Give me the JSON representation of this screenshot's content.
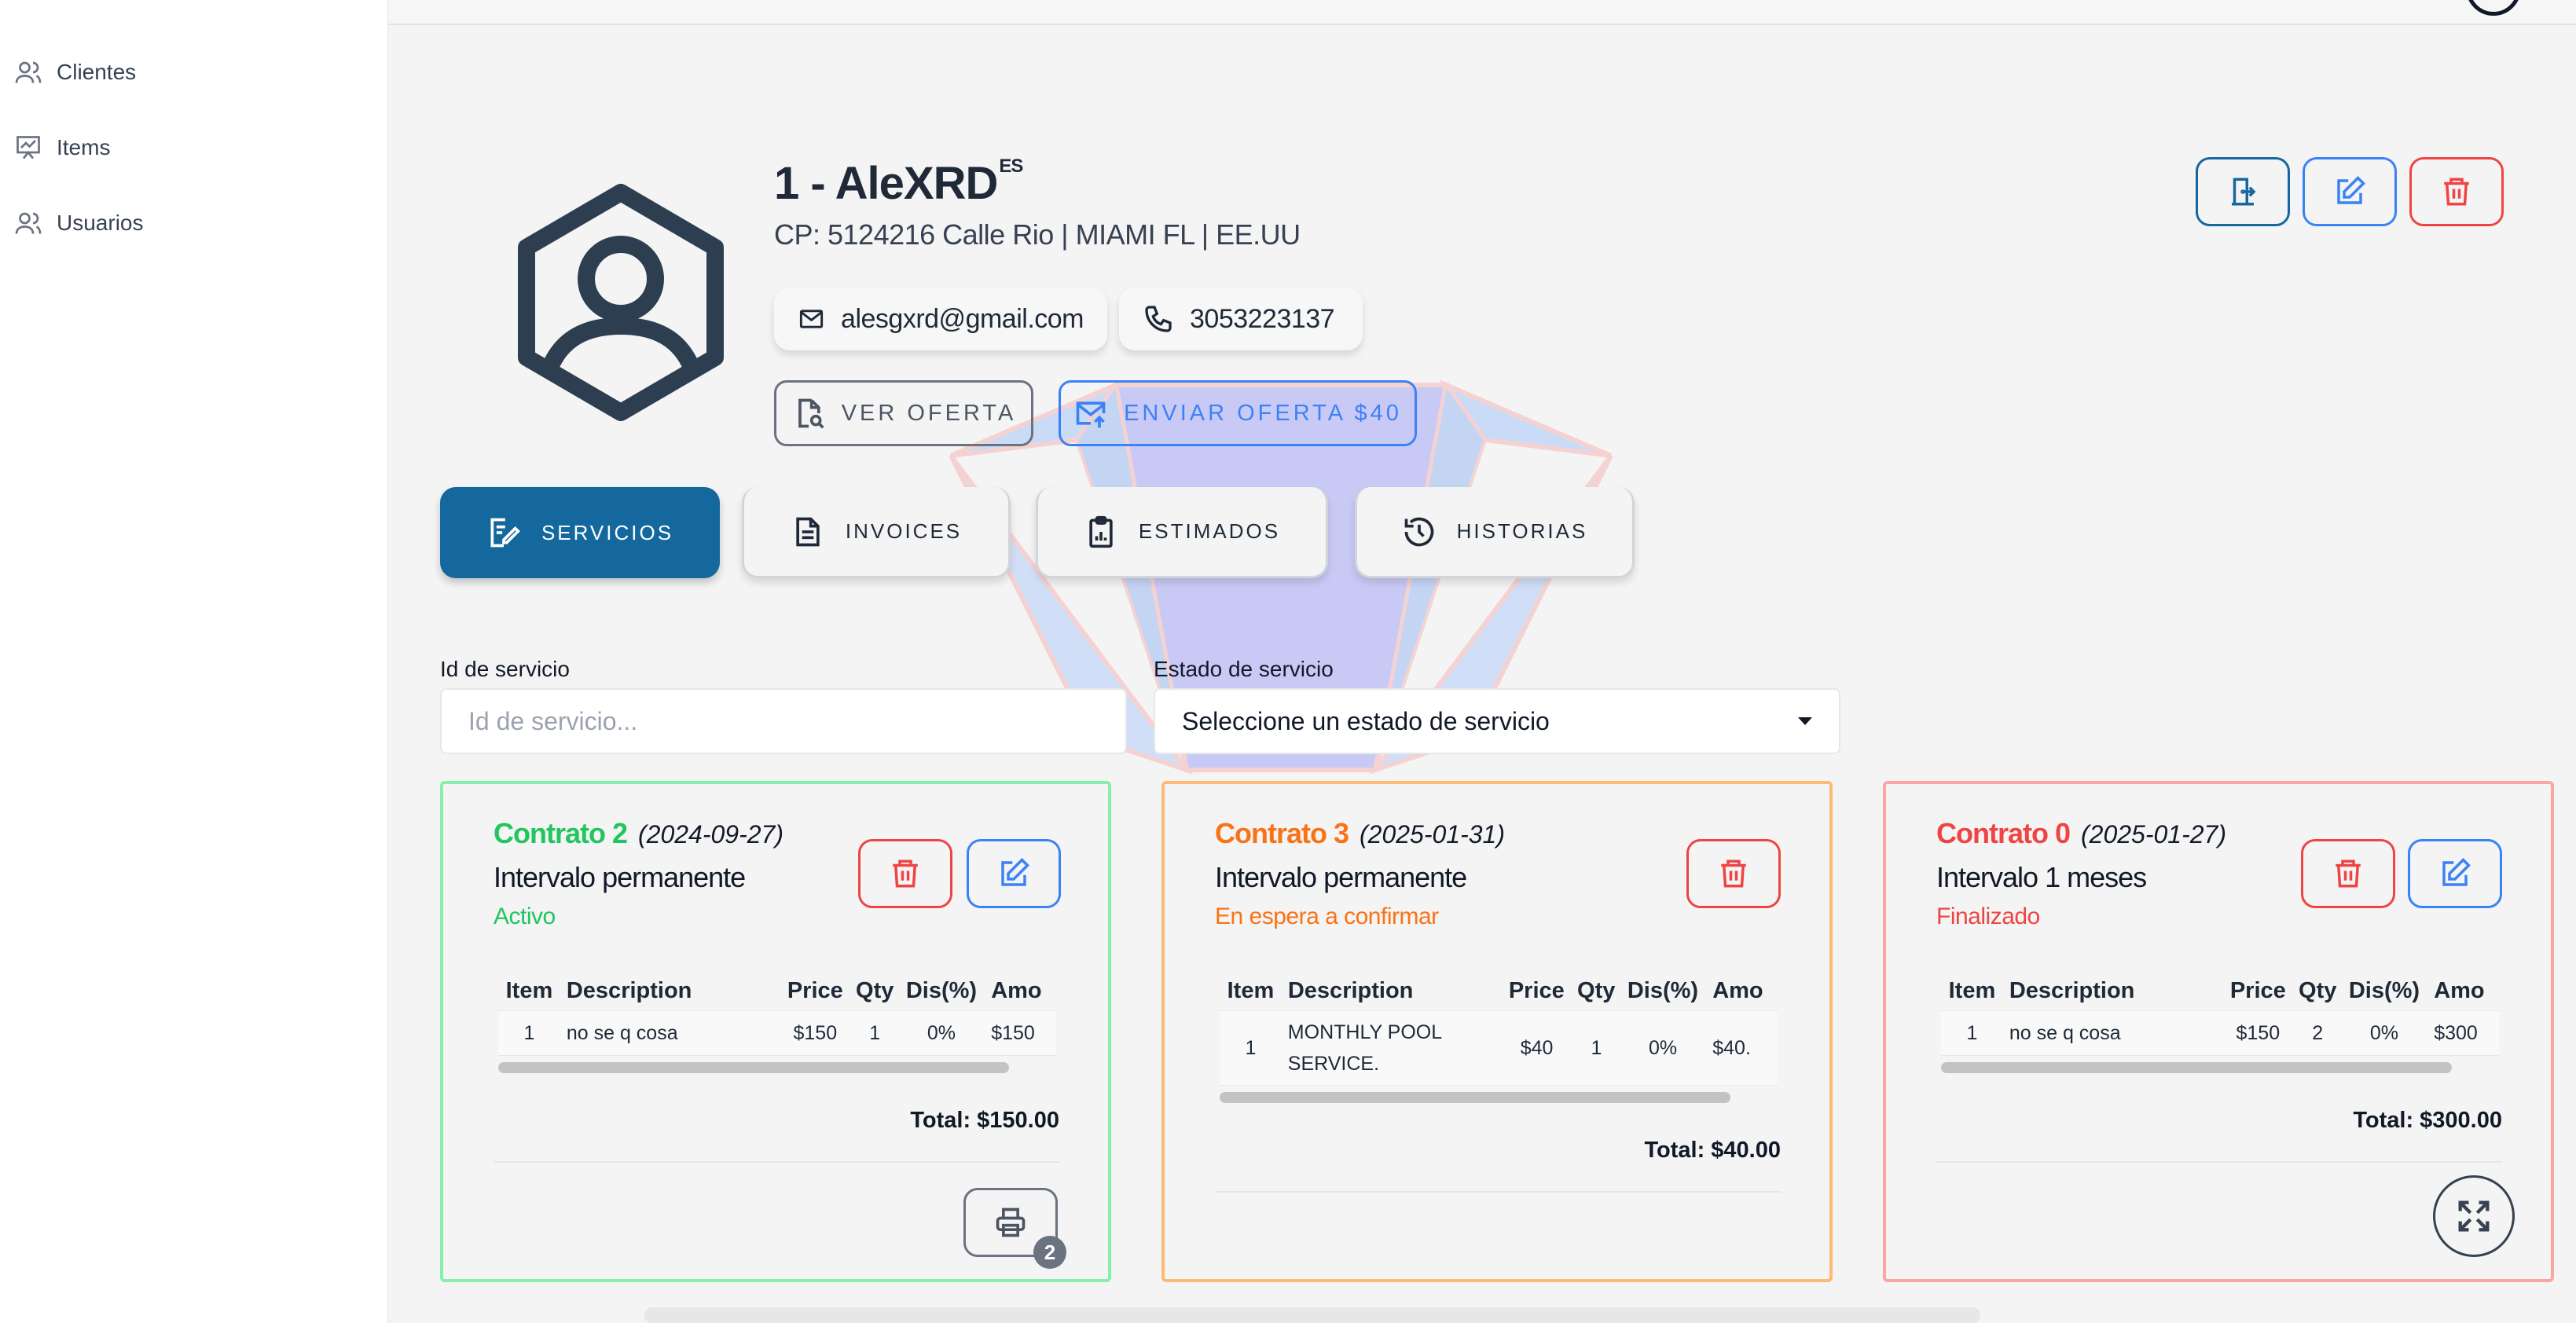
{
  "sidebar": {
    "items": [
      {
        "label": "Clientes",
        "icon": "users-icon"
      },
      {
        "label": "Items",
        "icon": "presentation-chart-icon"
      },
      {
        "label": "Usuarios",
        "icon": "users-icon"
      }
    ]
  },
  "client": {
    "name": "1 - AleXRD",
    "lang_tag": "ES",
    "address": "CP: 5124216  Calle Rio | MIAMI FL | EE.UU",
    "email": "alesgxrd@gmail.com",
    "phone": "3053223137"
  },
  "actions": {
    "ver_oferta": "VER OFERTA",
    "enviar_oferta": "ENVIAR OFERTA $40"
  },
  "header_buttons": [
    "door-exit-icon",
    "edit-icon",
    "trash-icon"
  ],
  "tabs": [
    {
      "label": "SERVICIOS",
      "icon": "edit-document-icon",
      "active": true
    },
    {
      "label": "INVOICES",
      "icon": "file-text-icon",
      "active": false
    },
    {
      "label": "ESTIMADOS",
      "icon": "clipboard-chart-icon",
      "active": false
    },
    {
      "label": "HISTORIAS",
      "icon": "history-icon",
      "active": false
    }
  ],
  "filters": {
    "id_label": "Id de servicio",
    "id_placeholder": "Id de servicio...",
    "id_value": "",
    "estado_label": "Estado de servicio",
    "estado_value": "Seleccione un estado de servicio"
  },
  "table_headers": {
    "item": "Item",
    "description": "Description",
    "price": "Price",
    "qty": "Qty",
    "dis": "Dis(%)",
    "amo": "Amo"
  },
  "contracts": [
    {
      "title": "Contrato 2",
      "date": "(2024-09-27)",
      "interval": "Intervalo permanente",
      "status": "Activo",
      "color": "#22c55e",
      "border": "#86efac",
      "rows": [
        {
          "item": "1",
          "description": "no se q cosa",
          "price": "$150",
          "qty": "1",
          "dis": "0%",
          "amo": "$150"
        }
      ],
      "total": "Total: $150.00",
      "print_count": "2"
    },
    {
      "title": "Contrato 3",
      "date": "(2025-01-31)",
      "interval": "Intervalo permanente",
      "status": "En espera a confirmar",
      "color": "#f97316",
      "border": "#fdba74",
      "rows": [
        {
          "item": "1",
          "description": "MONTHLY POOL SERVICE.",
          "price": "$40",
          "qty": "1",
          "dis": "0%",
          "amo": "$40."
        }
      ],
      "total": "Total: $40.00"
    },
    {
      "title": "Contrato 0",
      "date": "(2025-01-27)",
      "interval": "Intervalo 1 meses",
      "status": "Finalizado",
      "color": "#ef4444",
      "border": "#fca5a5",
      "rows": [
        {
          "item": "1",
          "description": "no se q cosa",
          "price": "$150",
          "qty": "2",
          "dis": "0%",
          "amo": "$300"
        }
      ],
      "total": "Total: $300.00"
    }
  ],
  "colors": {
    "primary": "#14689e",
    "edit_blue": "#3b82f6",
    "delete_red": "#ef4444",
    "active_green": "#22c55e",
    "pending_orange": "#f97316"
  }
}
